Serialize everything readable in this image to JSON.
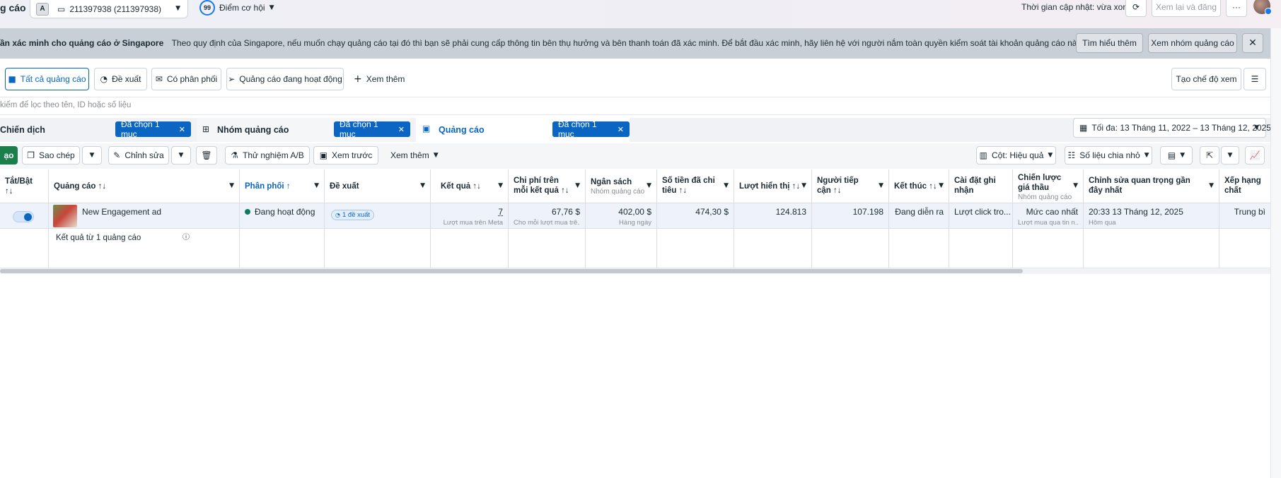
{
  "topbar": {
    "page_title_fragment": "g cáo",
    "account_badge": "A",
    "account_name": "211397938 (211397938)",
    "opportunity_score": "99",
    "opportunity_label": "Điểm cơ hội",
    "updated_text": "Thời gian cập nhật: vừa xong",
    "review_publish_label": "Xem lại và đăng",
    "more_label": "···"
  },
  "banner": {
    "title": "ần xác minh cho quảng cáo ở Singapore",
    "body": "Theo quy định của Singapore, nếu muốn chạy quảng cáo tại đó thì bạn sẽ phải cung cấp thông tin bên thụ hưởng và bên thanh toán đã xác minh. Để bắt đầu xác minh, hãy liên hệ với người nắm toàn quyền kiểm soát tài khoản quảng cáo này.",
    "learn_more": "Tìm hiểu thêm",
    "view_adsets": "Xem nhóm quảng cáo"
  },
  "tabs": {
    "all_ads": "Tất cả quảng cáo",
    "suggested": "Đề xuất",
    "delivering": "Có phân phối",
    "active_ads": "Quảng cáo đang hoạt động",
    "see_more": "Xem thêm",
    "create_view": "Tạo chế độ xem"
  },
  "search": {
    "placeholder": "kiếm để lọc theo tên, ID hoặc số liệu"
  },
  "levels": {
    "campaign": "Chiến dịch",
    "campaign_selected": "Đã chọn 1 mục",
    "adset": "Nhóm quảng cáo",
    "adset_selected": "Đã chọn 1 mục",
    "ad": "Quảng cáo",
    "ad_selected": "Đã chọn 1 mục",
    "date_range": "Tối đa: 13 Tháng 11, 2022 – 13 Tháng 12, 2025"
  },
  "toolbar": {
    "create": "ạo",
    "duplicate": "Sao chép",
    "edit": "Chỉnh sửa",
    "ab_test": "Thử nghiệm A/B",
    "preview": "Xem trước",
    "see_more": "Xem thêm",
    "columns": "Cột: Hiệu quả",
    "breakdown": "Số liệu chia nhỏ"
  },
  "table": {
    "headers": {
      "toggle": "Tắt/Bật",
      "toggle_sort": "↑↓",
      "ad": "Quảng cáo ↑↓",
      "delivery": "Phân phối ↑",
      "suggestions": "Đề xuất",
      "results": "Kết quả ↑↓",
      "cost_per_result": "Chi phí trên mỗi kết quả ↑↓",
      "budget": "Ngân sách",
      "budget_sub": "Nhóm quảng cáo",
      "amount_spent": "Số tiền đã chi tiêu ↑↓",
      "impressions": "Lượt hiển thị ↑↓",
      "reach": "Người tiếp cận ↑↓",
      "ends": "Kết thúc ↑↓",
      "attribution": "Cài đặt ghi nhận",
      "bid_strategy": "Chiến lược giá thầu",
      "bid_strategy_sub": "Nhóm quảng cáo",
      "last_edit": "Chỉnh sửa quan trọng gần đây nhất",
      "quality_ranking": "Xếp hạng chất lượng..."
    },
    "row": {
      "ad_name": "New Engagement ad",
      "delivery": "Đang hoạt động",
      "suggestions": "1 đề xuất",
      "results": "7",
      "results_sub": "Lượt mua trên Meta",
      "cost_per_result": "67,76 $",
      "cost_per_result_sub": "Cho mỗi lượt mua trê...",
      "budget": "402,00 $",
      "budget_sub": "Hàng ngày",
      "amount_spent": "474,30 $",
      "impressions": "124.813",
      "reach": "107.198",
      "ends": "Đang diễn ra",
      "attribution": "Lượt click tro...",
      "bid_strategy": "Mức cao nhất",
      "bid_strategy_sub": "Lượt mua qua tin n...",
      "last_edit": "20:33 13 Tháng 12, 2025",
      "last_edit_sub": "Hôm qua",
      "quality_ranking": "Trung bì"
    },
    "summary": "Kết quả từ 1 quảng cáo"
  },
  "colors": {
    "accent": "#0a66c2",
    "active_dot": "#0f7b5f",
    "banner_bg": "#c9cfd7"
  }
}
